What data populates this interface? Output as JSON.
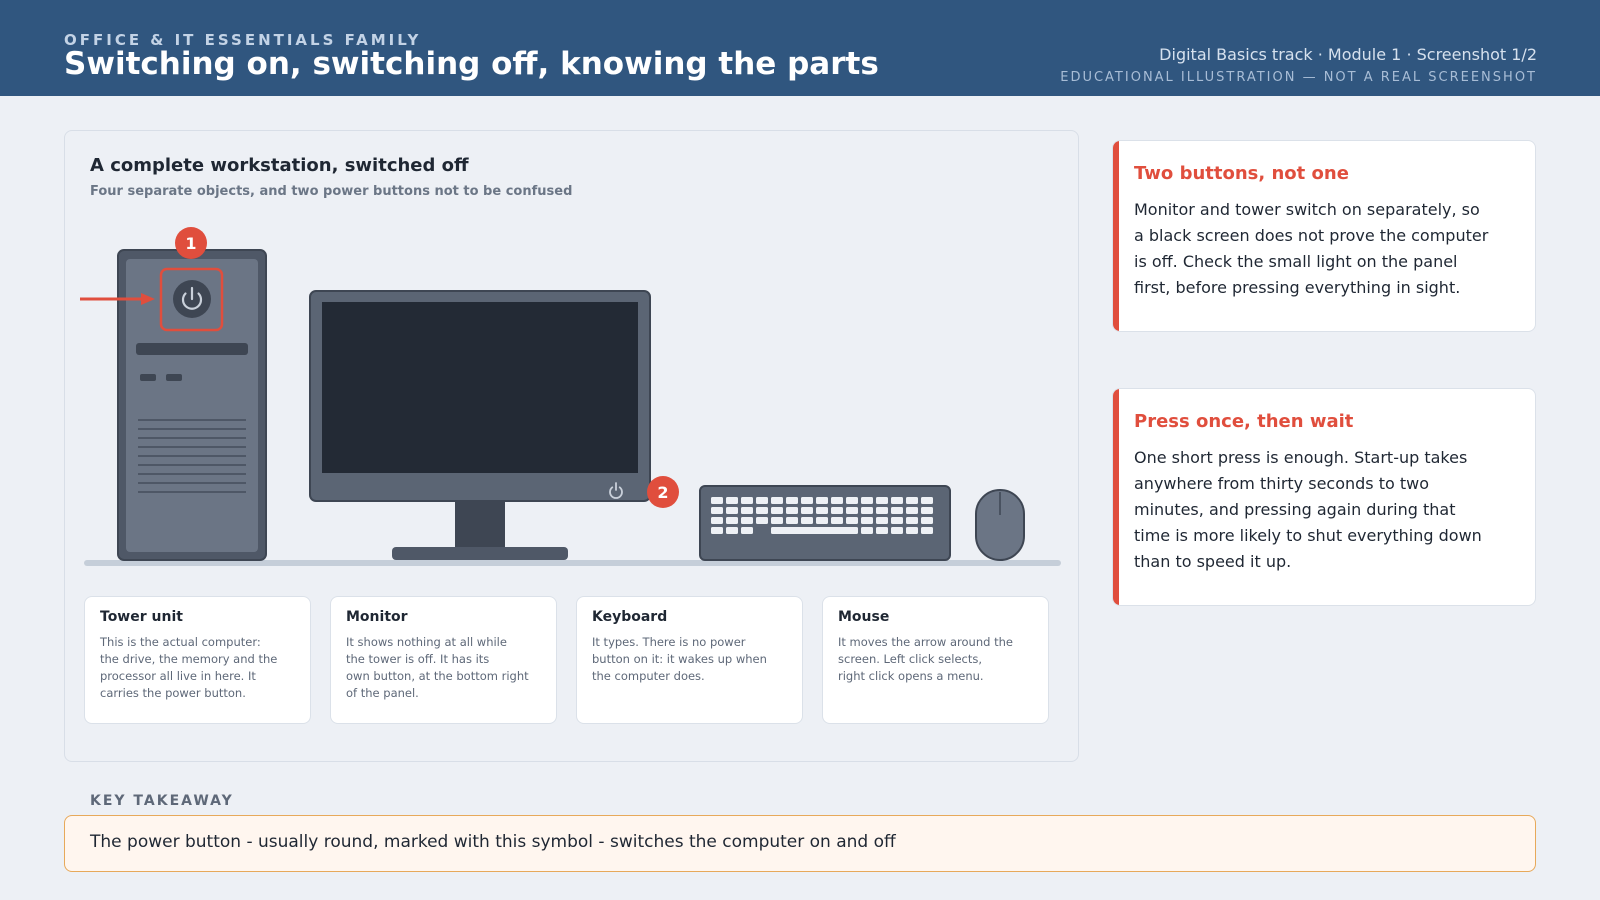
{
  "header": {
    "kicker": "OFFICE & IT ESSENTIALS FAMILY",
    "title": "Switching on, switching off, knowing the parts",
    "track": "Digital Basics track · Module 1 · Screenshot 1/2",
    "disclaimer": "EDUCATIONAL ILLUSTRATION — NOT A REAL SCREENSHOT"
  },
  "panel": {
    "title": "A complete workstation, switched off",
    "subtitle": "Four separate objects, and two power buttons not to be confused",
    "markers": [
      "1",
      "2"
    ]
  },
  "parts": [
    {
      "name": "Tower unit",
      "description": "This is the actual computer:\nthe drive, the memory and the\nprocessor all live in here. It\ncarries the power button."
    },
    {
      "name": "Monitor",
      "description": "It shows nothing at all while\nthe tower is off. It has its\nown button, at the bottom right\nof the panel."
    },
    {
      "name": "Keyboard",
      "description": "It types. There is no power\nbutton on it: it wakes up when\nthe computer does."
    },
    {
      "name": "Mouse",
      "description": "It moves the arrow around the\nscreen. Left click selects,\nright click opens a menu."
    }
  ],
  "tips": [
    {
      "title": "Two buttons, not one",
      "body": "Monitor and tower switch on separately, so\na black screen does not prove the computer\nis off. Check the small light on the panel\nfirst, before pressing everything in sight."
    },
    {
      "title": "Press once, then wait",
      "body": "One short press is enough. Start-up takes\nanywhere from thirty seconds to two\nminutes, and pressing again during that\ntime is more likely to shut everything down\nthan to speed it up."
    }
  ],
  "takeaway": {
    "label": "KEY TAKEAWAY",
    "text": "The power button - usually round, marked with this symbol - switches the computer on and off"
  },
  "colors": {
    "header_bg": "#30567f",
    "accent_red": "#e04e3d",
    "takeaway_border": "#e7a95a",
    "device_body": "#5b6574",
    "screen": "#232a35"
  },
  "icons": {
    "tower_power": "power-icon",
    "monitor_power": "power-icon",
    "pointer": "arrow-right-icon"
  }
}
